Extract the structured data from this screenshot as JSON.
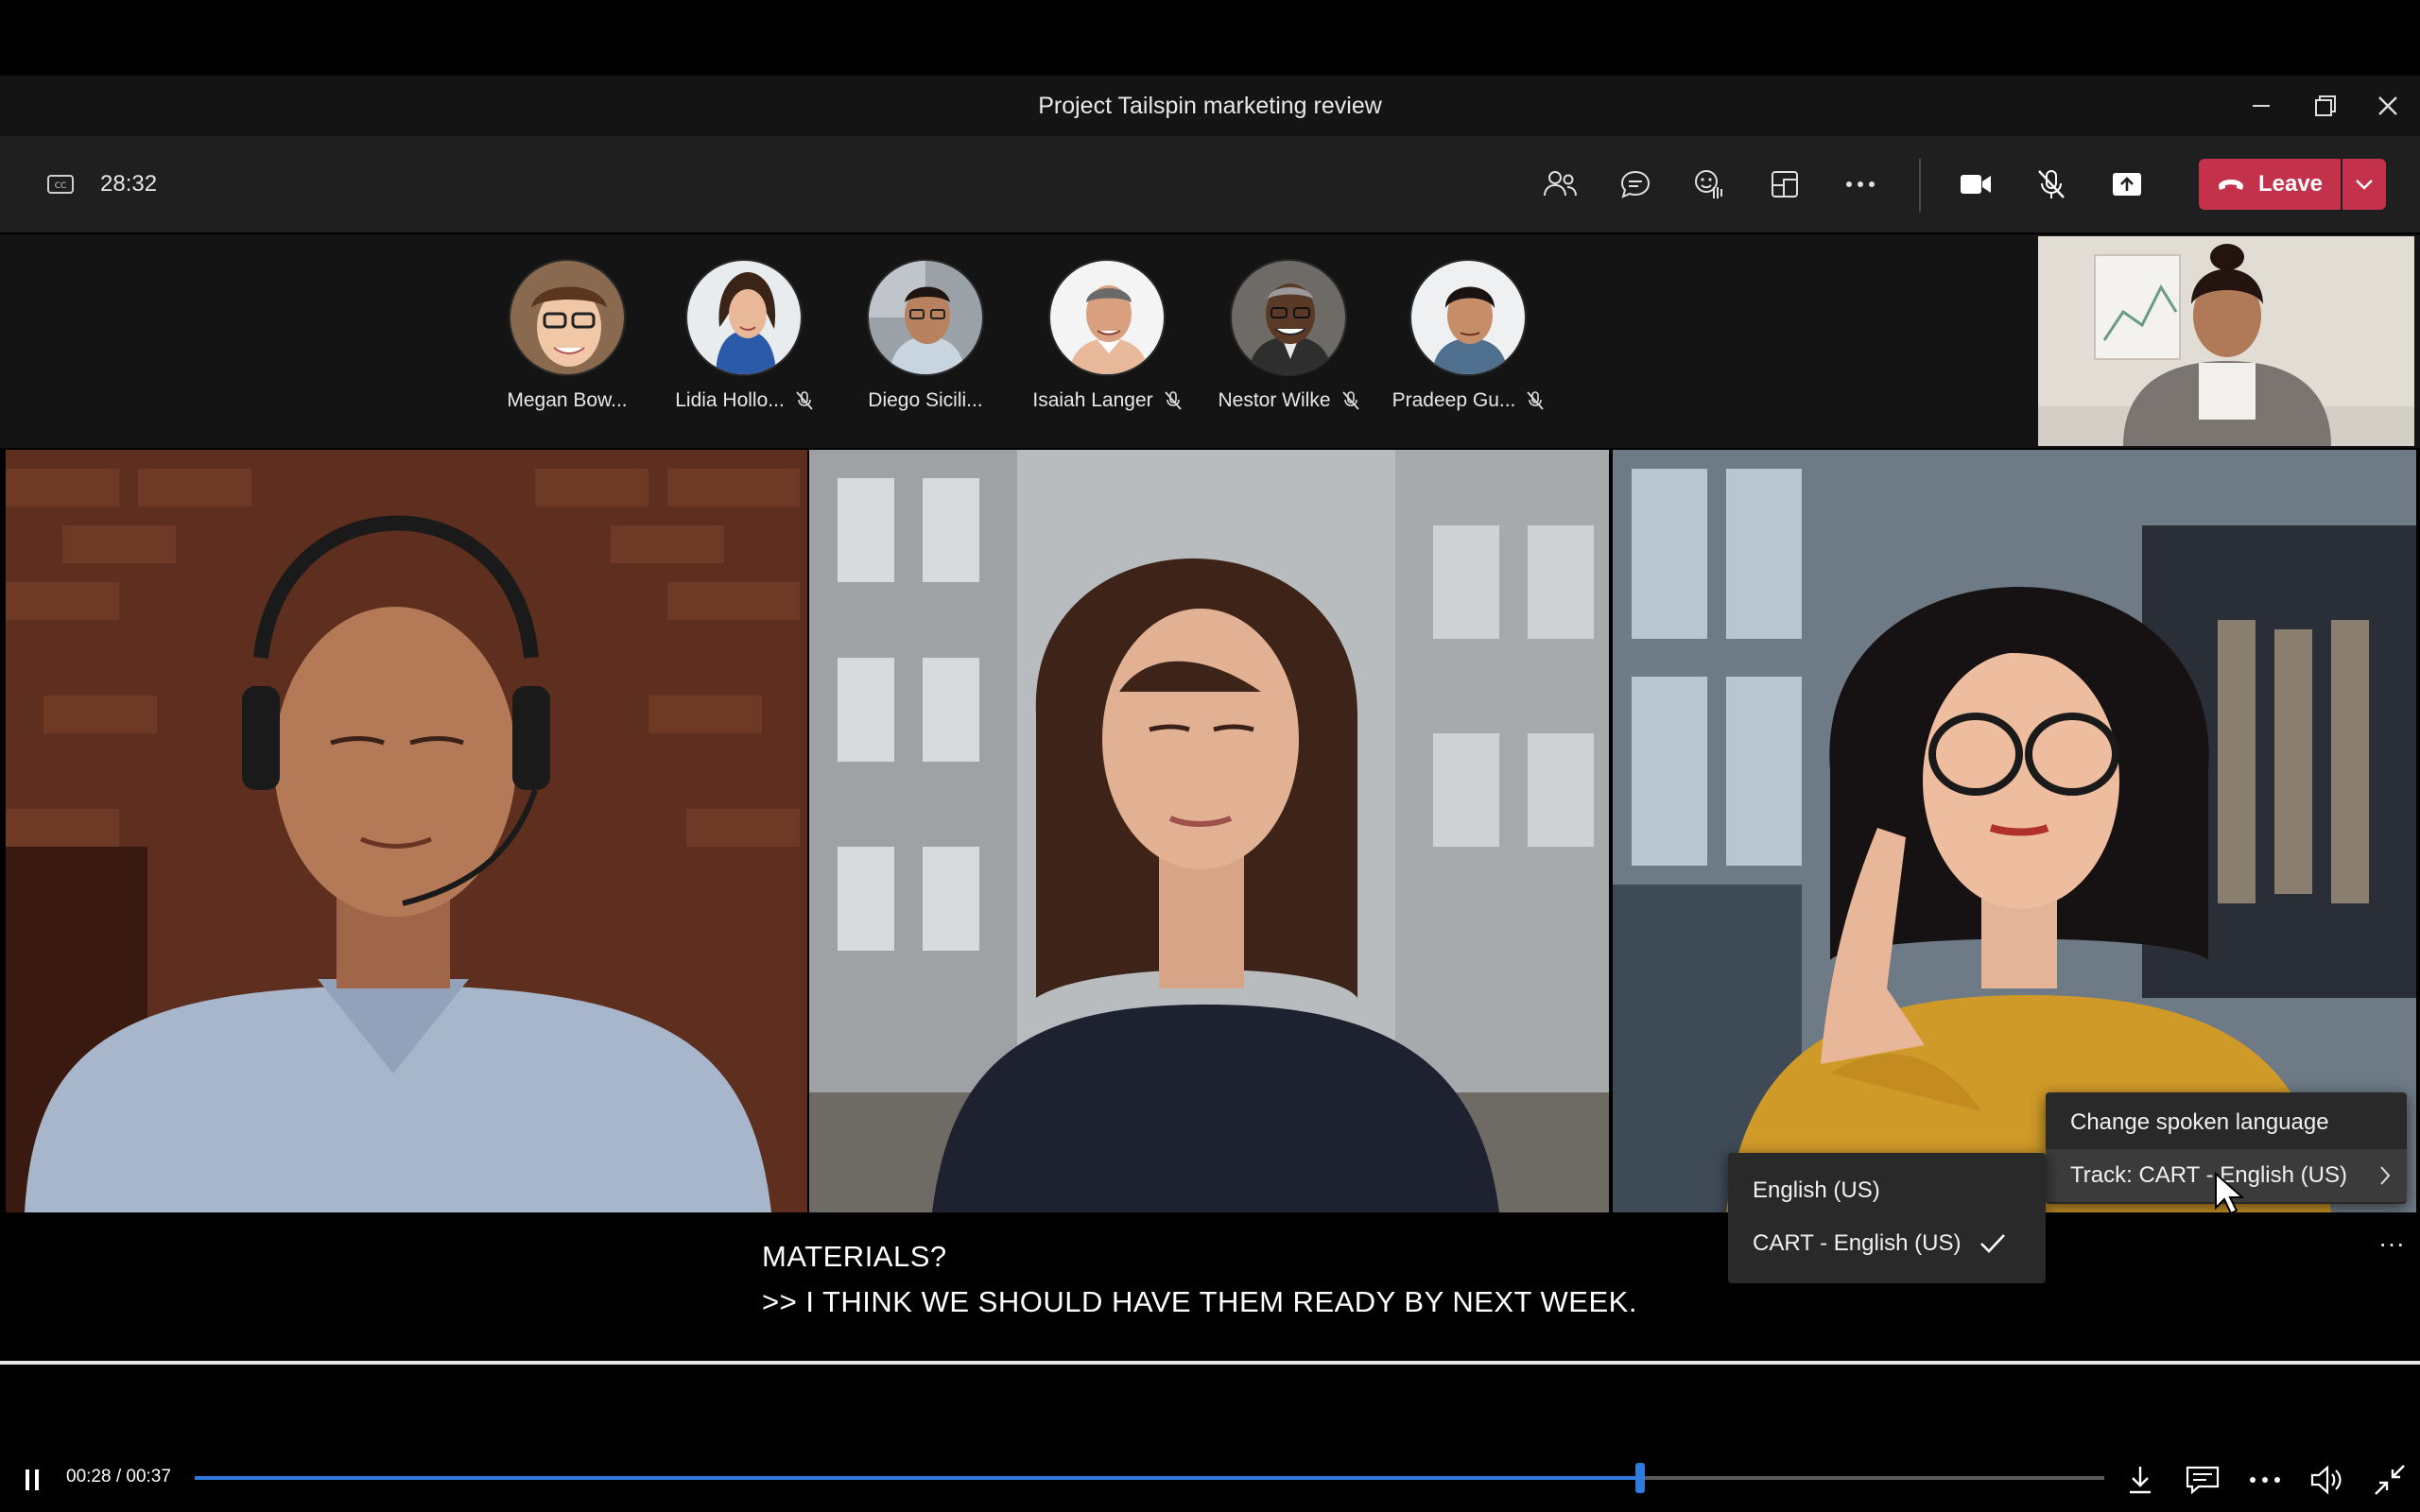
{
  "window": {
    "title": "Project Tailspin marketing review"
  },
  "toolbar": {
    "meeting_timer": "28:32",
    "leave_label": "Leave"
  },
  "participants": [
    {
      "name": "Megan Bow...",
      "muted": false
    },
    {
      "name": "Lidia Hollo...",
      "muted": true
    },
    {
      "name": "Diego Sicili...",
      "muted": false
    },
    {
      "name": "Isaiah Langer",
      "muted": true
    },
    {
      "name": "Nestor Wilke",
      "muted": true
    },
    {
      "name": "Pradeep Gu...",
      "muted": true
    }
  ],
  "captions": {
    "line1": "MATERIALS?",
    "line2": ">> I THINK WE SHOULD HAVE THEM READY BY NEXT WEEK.",
    "more": "···"
  },
  "captions_menu": {
    "change_language": "Change spoken language",
    "track": "Track: CART - English (US)"
  },
  "track_submenu": {
    "options": [
      "English (US)",
      "CART - English (US)"
    ],
    "selected_index": 1
  },
  "player": {
    "time": "00:28 / 00:37",
    "progress_fraction": 0.757
  },
  "colors": {
    "leave": "#c4314b",
    "progress": "#2f7bdc"
  }
}
